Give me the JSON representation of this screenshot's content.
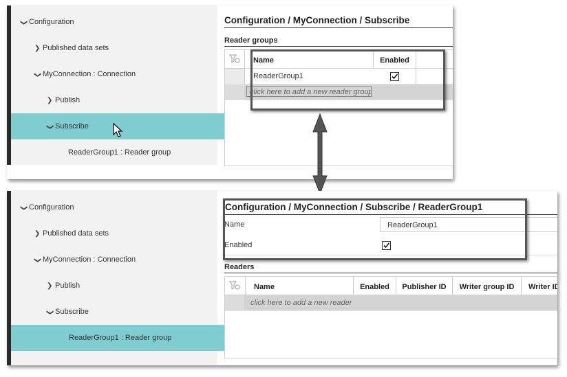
{
  "top_panel": {
    "tree": {
      "items": [
        {
          "label": "Configuration",
          "chevron": "down"
        },
        {
          "label": "Published data sets",
          "chevron": "right"
        },
        {
          "label": "MyConnection : Connection",
          "chevron": "down"
        },
        {
          "label": "Publish",
          "chevron": "right"
        },
        {
          "label": "Subscribe",
          "chevron": "down",
          "selected": true
        },
        {
          "label": "ReaderGroup1 : Reader group",
          "chevron": "none"
        }
      ]
    },
    "title": "Configuration / MyConnection / Subscribe",
    "section": "Reader groups",
    "grid": {
      "columns": [
        "Name",
        "Enabled"
      ],
      "rows": [
        {
          "name": "ReaderGroup1",
          "enabled": true
        }
      ],
      "add_placeholder": "click here to add a new reader group"
    }
  },
  "bottom_panel": {
    "tree": {
      "items": [
        {
          "label": "Configuration",
          "chevron": "down"
        },
        {
          "label": "Published data sets",
          "chevron": "right"
        },
        {
          "label": "MyConnection : Connection",
          "chevron": "down"
        },
        {
          "label": "Publish",
          "chevron": "right"
        },
        {
          "label": "Subscribe",
          "chevron": "down"
        },
        {
          "label": "ReaderGroup1 : Reader group",
          "chevron": "none",
          "selected": true
        }
      ]
    },
    "title": "Configuration / MyConnection / Subscribe / ReaderGroup1",
    "fields": {
      "name_label": "Name",
      "name_value": "ReaderGroup1",
      "enabled_label": "Enabled",
      "enabled_value": true
    },
    "section": "Readers",
    "grid": {
      "columns": [
        "Name",
        "Enabled",
        "Publisher ID",
        "Writer group ID",
        "Writer ID"
      ],
      "add_placeholder": "click here to add a new reader"
    }
  },
  "colors": {
    "selected_bg": "#7fcdd0",
    "tree_bg": "#f2f2f2",
    "add_row_bg": "#d4d4d4"
  },
  "icons": {
    "filter": "filter-clear-icon",
    "checkmark": "checkmark-icon",
    "cursor": "mouse-cursor-icon",
    "link": "double-arrow-icon"
  }
}
